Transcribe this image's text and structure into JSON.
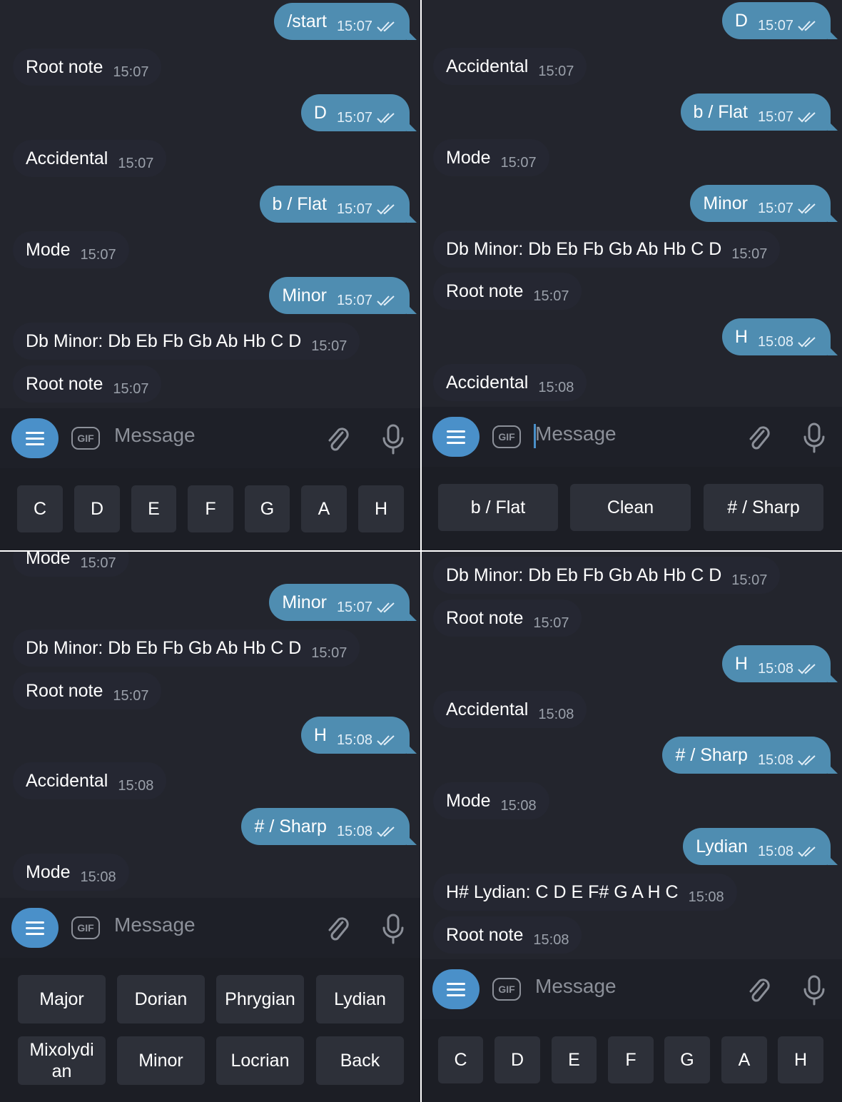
{
  "composer": {
    "placeholder": "Message",
    "gif_label": "GIF"
  },
  "panels": [
    {
      "messages": [
        {
          "side": "out",
          "text": "/start",
          "time": "15:07"
        },
        {
          "side": "in",
          "text": "Root note",
          "time": "15:07"
        },
        {
          "side": "out",
          "text": "D",
          "time": "15:07"
        },
        {
          "side": "in",
          "text": "Accidental",
          "time": "15:07"
        },
        {
          "side": "out",
          "text": "b / Flat",
          "time": "15:07"
        },
        {
          "side": "in",
          "text": "Mode",
          "time": "15:07"
        },
        {
          "side": "out",
          "text": "Minor",
          "time": "15:07"
        },
        {
          "side": "in",
          "text": "Db Minor: Db Eb Fb Gb Ab Hb C D",
          "time": "15:07"
        },
        {
          "side": "in",
          "text": "Root note",
          "time": "15:07"
        }
      ],
      "keyboard": [
        "C",
        "D",
        "E",
        "F",
        "G",
        "A",
        "H"
      ]
    },
    {
      "messages": [
        {
          "side": "out",
          "text": "D",
          "time": "15:07"
        },
        {
          "side": "in",
          "text": "Accidental",
          "time": "15:07"
        },
        {
          "side": "out",
          "text": "b / Flat",
          "time": "15:07"
        },
        {
          "side": "in",
          "text": "Mode",
          "time": "15:07"
        },
        {
          "side": "out",
          "text": "Minor",
          "time": "15:07"
        },
        {
          "side": "in",
          "text": "Db Minor: Db Eb Fb Gb Ab Hb C D",
          "time": "15:07"
        },
        {
          "side": "in",
          "text": "Root note",
          "time": "15:07"
        },
        {
          "side": "out",
          "text": "H",
          "time": "15:08"
        },
        {
          "side": "in",
          "text": "Accidental",
          "time": "15:08"
        }
      ],
      "keyboard": [
        "b / Flat",
        "Clean",
        "# / Sharp"
      ]
    },
    {
      "messages": [
        {
          "side": "in",
          "text": "Mode",
          "time": "15:07"
        },
        {
          "side": "out",
          "text": "Minor",
          "time": "15:07"
        },
        {
          "side": "in",
          "text": "Db Minor: Db Eb Fb Gb Ab Hb C D",
          "time": "15:07"
        },
        {
          "side": "in",
          "text": "Root note",
          "time": "15:07"
        },
        {
          "side": "out",
          "text": "H",
          "time": "15:08"
        },
        {
          "side": "in",
          "text": "Accidental",
          "time": "15:08"
        },
        {
          "side": "out",
          "text": "# / Sharp",
          "time": "15:08"
        },
        {
          "side": "in",
          "text": "Mode",
          "time": "15:08"
        }
      ],
      "keyboard": [
        "Major",
        "Dorian",
        "Phrygian",
        "Lydian",
        "Mixolydi an",
        "Minor",
        "Locrian",
        "Back"
      ]
    },
    {
      "messages": [
        {
          "side": "in",
          "text": "Db Minor: Db Eb Fb Gb Ab Hb C D",
          "time": "15:07"
        },
        {
          "side": "in",
          "text": "Root note",
          "time": "15:07"
        },
        {
          "side": "out",
          "text": "H",
          "time": "15:08"
        },
        {
          "side": "in",
          "text": "Accidental",
          "time": "15:08"
        },
        {
          "side": "out",
          "text": "# / Sharp",
          "time": "15:08"
        },
        {
          "side": "in",
          "text": "Mode",
          "time": "15:08"
        },
        {
          "side": "out",
          "text": "Lydian",
          "time": "15:08"
        },
        {
          "side": "in",
          "text": "H# Lydian: C D E F# G A H C",
          "time": "15:08"
        },
        {
          "side": "in",
          "text": "Root note",
          "time": "15:08"
        }
      ],
      "keyboard": [
        "C",
        "D",
        "E",
        "F",
        "G",
        "A",
        "H"
      ]
    }
  ]
}
